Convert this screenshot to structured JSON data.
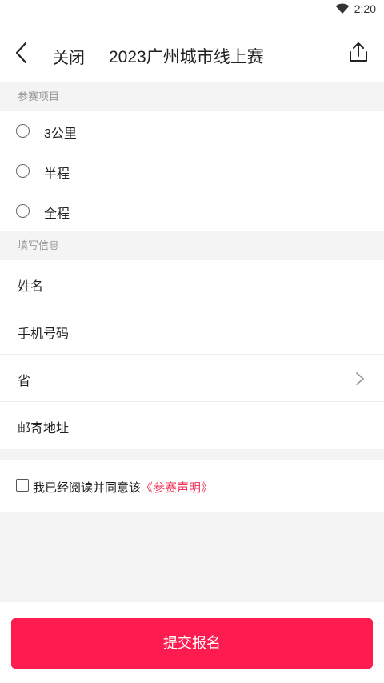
{
  "status_bar": {
    "time": "2:20"
  },
  "nav": {
    "close_label": "关闭",
    "title": "2023广州城市线上赛"
  },
  "sections": {
    "event_header": "参赛项目",
    "info_header": "填写信息"
  },
  "events": [
    {
      "label": "3公里"
    },
    {
      "label": "半程"
    },
    {
      "label": "全程"
    }
  ],
  "fields": [
    {
      "label": "姓名"
    },
    {
      "label": "手机号码"
    },
    {
      "label": "省"
    },
    {
      "label": "邮寄地址"
    }
  ],
  "agreement": {
    "text": "我已经阅读并同意该",
    "link": "《参赛声明》"
  },
  "submit": {
    "label": "提交报名"
  },
  "colors": {
    "accent": "#fd1b4f",
    "link": "#f0365a"
  }
}
